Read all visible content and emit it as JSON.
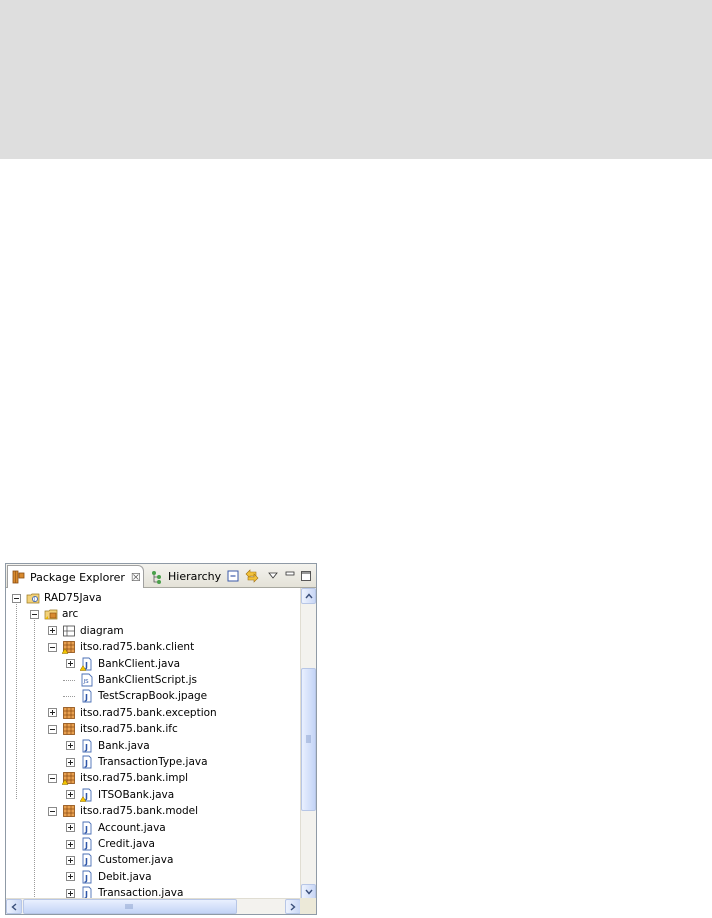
{
  "tabs": {
    "package_explorer": "Package Explorer",
    "hierarchy": "Hierarchy",
    "close_glyph": "☒"
  },
  "toolbar": {
    "collapse_all": "collapse-all-icon",
    "link_with_editor": "link-with-editor-icon",
    "view_menu": "view-menu-icon",
    "minimize": "minimize-icon",
    "maximize": "maximize-icon"
  },
  "tree": [
    {
      "label": "RAD75Java",
      "icon": "java-project-icon",
      "depth": 0,
      "toggle": "minus"
    },
    {
      "label": "arc",
      "icon": "source-folder-icon",
      "depth": 1,
      "toggle": "minus"
    },
    {
      "label": "diagram",
      "icon": "diagram-folder-icon",
      "depth": 2,
      "toggle": "plus"
    },
    {
      "label": "itso.rad75.bank.client",
      "icon": "package-warning-icon",
      "depth": 2,
      "toggle": "minus"
    },
    {
      "label": "BankClient.java",
      "icon": "java-file-warning-icon",
      "depth": 3,
      "toggle": "plus"
    },
    {
      "label": "BankClientScript.js",
      "icon": "js-file-icon",
      "depth": 3,
      "toggle": "none"
    },
    {
      "label": "TestScrapBook.jpage",
      "icon": "jpage-file-icon",
      "depth": 3,
      "toggle": "none"
    },
    {
      "label": "itso.rad75.bank.exception",
      "icon": "package-icon",
      "depth": 2,
      "toggle": "plus"
    },
    {
      "label": "itso.rad75.bank.ifc",
      "icon": "package-icon",
      "depth": 2,
      "toggle": "minus"
    },
    {
      "label": "Bank.java",
      "icon": "java-file-icon",
      "depth": 3,
      "toggle": "plus"
    },
    {
      "label": "TransactionType.java",
      "icon": "java-file-icon",
      "depth": 3,
      "toggle": "plus"
    },
    {
      "label": "itso.rad75.bank.impl",
      "icon": "package-warning-icon",
      "depth": 2,
      "toggle": "minus"
    },
    {
      "label": "ITSOBank.java",
      "icon": "java-file-warning-icon",
      "depth": 3,
      "toggle": "plus"
    },
    {
      "label": "itso.rad75.bank.model",
      "icon": "package-icon",
      "depth": 2,
      "toggle": "minus"
    },
    {
      "label": "Account.java",
      "icon": "java-file-icon",
      "depth": 3,
      "toggle": "plus"
    },
    {
      "label": "Credit.java",
      "icon": "java-file-icon",
      "depth": 3,
      "toggle": "plus"
    },
    {
      "label": "Customer.java",
      "icon": "java-file-icon",
      "depth": 3,
      "toggle": "plus"
    },
    {
      "label": "Debit.java",
      "icon": "java-file-icon",
      "depth": 3,
      "toggle": "plus"
    },
    {
      "label": "Transaction.java",
      "icon": "java-file-icon",
      "depth": 3,
      "toggle": "plus"
    }
  ],
  "colors": {
    "package": "#c86a1e",
    "java_file": "#4a6fb5",
    "warning": "#e8b400",
    "scroll_blue": "#c4d4f6"
  }
}
